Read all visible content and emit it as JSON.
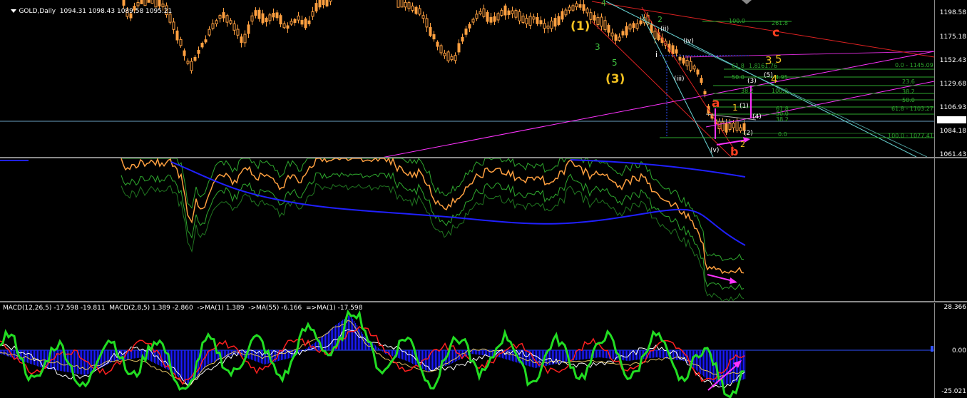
{
  "price_pane": {
    "header": "GOLD,Daily  1094.31 1098.43 1089.58 1095.21",
    "axis_labels": [
      "1198.58",
      "1175.18",
      "1152.43",
      "1129.68",
      "1106.93",
      "1084.18",
      "1061.43"
    ],
    "current_price": "1095.21",
    "wave_labels": {
      "w1": "(1)",
      "w3": "(3)",
      "w5_small": "5",
      "w3_small": "3",
      "w4_top": "4",
      "w2_top": "2",
      "i": "i",
      "ii": "(ii)",
      "iii": "(iii)",
      "iv": "(iv)",
      "ii2": "(ii)",
      "a": "a",
      "b": "b",
      "c": "c",
      "b2": "2",
      "one": "1",
      "v": "(v)",
      "c3": "3",
      "c5": "5",
      "c4": "4",
      "circ3": "(3)",
      "circ5": "(5)",
      "circ4": "(4)",
      "circ2": "(2)",
      "circ1": "(1)"
    },
    "fib_labels": [
      "100.0",
      "261.8",
      "0.0 - 1145.09",
      "61.8",
      "50.0",
      "38.2",
      "23.6",
      "38.2",
      "50.0",
      "61.8",
      "100.0",
      "61.8 - 1103.27",
      "50.0",
      "38.2",
      "0.0",
      "100.0 - 1077.41",
      "1.8",
      "161.76",
      "4.95"
    ]
  },
  "indicator_pane": {},
  "macd_pane": {
    "header": "MACD(12,26,5) -17.598 -19.811  MACD(2,8,5) 1.389 -2.860  ->MA(1) 1.389  ->MA(55) -6.166  =>MA(1) -17.598",
    "axis_labels": [
      "28.366",
      "0.00",
      "-25.021"
    ]
  },
  "colors": {
    "candle_up": "#ffa040",
    "candle_down": "#ffa040",
    "macd_hist": "#1a1aff",
    "macd_green": "#22dd22",
    "macd_red": "#ff2020",
    "ma_blue": "#2020ff",
    "magenta": "#ff33ff",
    "fib_green": "#2ea82e",
    "cyan": "#6ad6d6",
    "red_line": "#dd2222",
    "wave_yellow": "#f0c020",
    "wave_green": "#3fbf3f"
  }
}
